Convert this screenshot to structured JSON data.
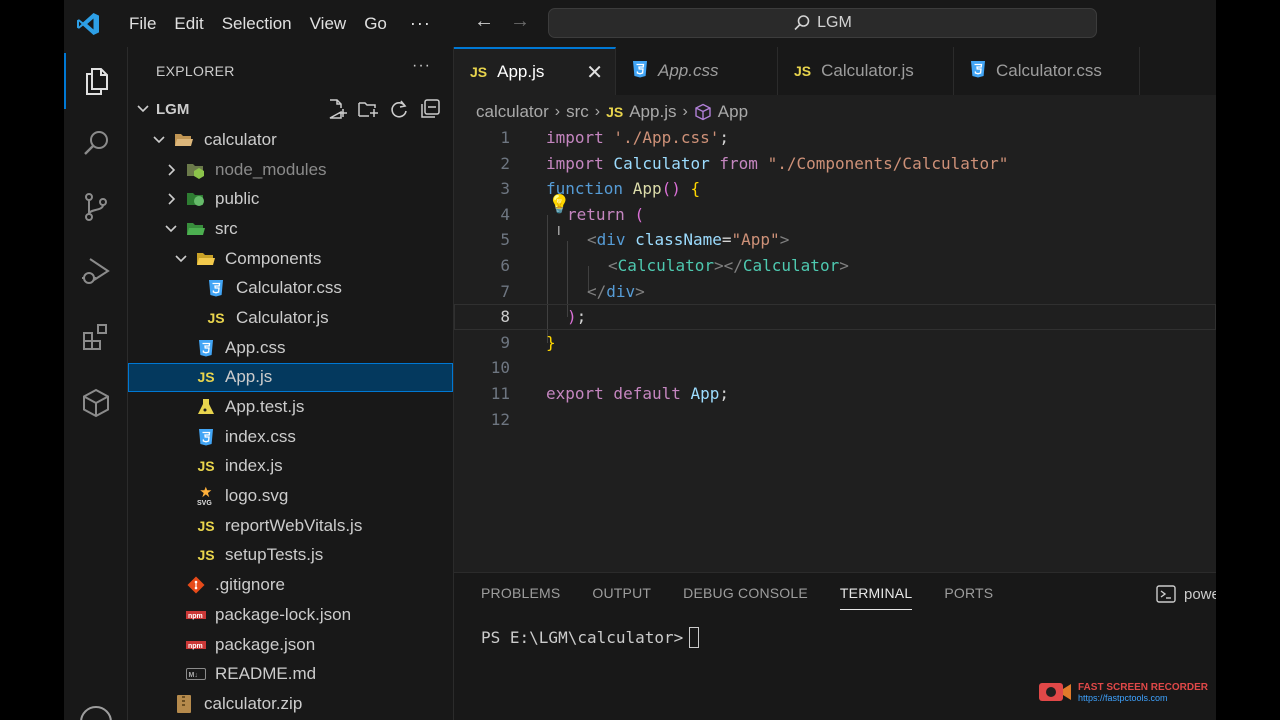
{
  "titlebar": {
    "menu": [
      "File",
      "Edit",
      "Selection",
      "View",
      "Go"
    ],
    "more": "···",
    "search_text": "LGM"
  },
  "activity_bar": {
    "items": [
      "explorer-icon",
      "search-icon",
      "source-control-icon",
      "run-debug-icon",
      "extensions-icon",
      "package-icon"
    ]
  },
  "explorer": {
    "title": "EXPLORER",
    "more": "···",
    "root": "LGM",
    "tree": [
      {
        "label": "calculator",
        "indent": 1,
        "type": "folder",
        "open": true,
        "icon": "folder"
      },
      {
        "label": "node_modules",
        "indent": 2,
        "type": "folder",
        "open": false,
        "icon": "node",
        "dim": true
      },
      {
        "label": "public",
        "indent": 2,
        "type": "folder",
        "open": false,
        "icon": "public"
      },
      {
        "label": "src",
        "indent": 2,
        "type": "folder",
        "open": true,
        "icon": "src"
      },
      {
        "label": "Components",
        "indent": 3,
        "type": "folder",
        "open": true,
        "icon": "components"
      },
      {
        "label": "Calculator.css",
        "indent": 4,
        "type": "file",
        "icon": "css"
      },
      {
        "label": "Calculator.js",
        "indent": 4,
        "type": "file",
        "icon": "js"
      },
      {
        "label": "App.css",
        "indent": 3,
        "type": "file",
        "icon": "css"
      },
      {
        "label": "App.js",
        "indent": 3,
        "type": "file",
        "icon": "js",
        "selected": true
      },
      {
        "label": "App.test.js",
        "indent": 3,
        "type": "file",
        "icon": "test"
      },
      {
        "label": "index.css",
        "indent": 3,
        "type": "file",
        "icon": "css"
      },
      {
        "label": "index.js",
        "indent": 3,
        "type": "file",
        "icon": "js"
      },
      {
        "label": "logo.svg",
        "indent": 3,
        "type": "file",
        "icon": "svg"
      },
      {
        "label": "reportWebVitals.js",
        "indent": 3,
        "type": "file",
        "icon": "js"
      },
      {
        "label": "setupTests.js",
        "indent": 3,
        "type": "file",
        "icon": "js"
      },
      {
        "label": ".gitignore",
        "indent": 2,
        "type": "file",
        "icon": "git"
      },
      {
        "label": "package-lock.json",
        "indent": 2,
        "type": "file",
        "icon": "npm"
      },
      {
        "label": "package.json",
        "indent": 2,
        "type": "file",
        "icon": "npm"
      },
      {
        "label": "README.md",
        "indent": 2,
        "type": "file",
        "icon": "md"
      },
      {
        "label": "calculator.zip",
        "indent": 1,
        "type": "file",
        "icon": "zip"
      }
    ]
  },
  "tabs": [
    {
      "label": "App.js",
      "icon": "js",
      "active": true,
      "close": "✕"
    },
    {
      "label": "App.css",
      "icon": "css",
      "italic": true
    },
    {
      "label": "Calculator.js",
      "icon": "js"
    },
    {
      "label": "Calculator.css",
      "icon": "css"
    }
  ],
  "breadcrumb": {
    "parts": [
      "calculator",
      "src",
      "App.js",
      "App"
    ]
  },
  "editor": {
    "current_line": 8,
    "lines": [
      {
        "n": "1"
      },
      {
        "n": "2"
      },
      {
        "n": "3"
      },
      {
        "n": "4"
      },
      {
        "n": "5"
      },
      {
        "n": "6"
      },
      {
        "n": "7"
      },
      {
        "n": "8"
      },
      {
        "n": "9"
      },
      {
        "n": "10"
      },
      {
        "n": "11"
      },
      {
        "n": "12"
      }
    ],
    "code": {
      "l1": [
        "import",
        " './App.css'",
        ";"
      ],
      "l2": [
        "import",
        " Calculator",
        " from",
        " \"./Components/Calculator\""
      ],
      "l3": [
        "function",
        " App",
        "(",
        ")",
        " ",
        "{"
      ],
      "l4": [
        "return",
        " ",
        "("
      ],
      "l5": [
        "<",
        "div",
        " className",
        "=",
        "\"App\"",
        ">"
      ],
      "l6": [
        "<",
        "Calculator",
        "></",
        "Calculator",
        ">"
      ],
      "l7": [
        "</",
        "div",
        ">"
      ],
      "l8": [
        ")",
        ";"
      ],
      "l9": [
        "}"
      ],
      "l11": [
        "export",
        " default",
        " App",
        ";"
      ]
    }
  },
  "panel": {
    "tabs": [
      "PROBLEMS",
      "OUTPUT",
      "DEBUG CONSOLE",
      "TERMINAL",
      "PORTS"
    ],
    "active_tab": "TERMINAL",
    "terminal_name": "powe",
    "prompt": "PS E:\\LGM\\calculator>"
  },
  "watermark": {
    "title": "FAST SCREEN RECORDER",
    "url": "https://fastpctools.com"
  }
}
